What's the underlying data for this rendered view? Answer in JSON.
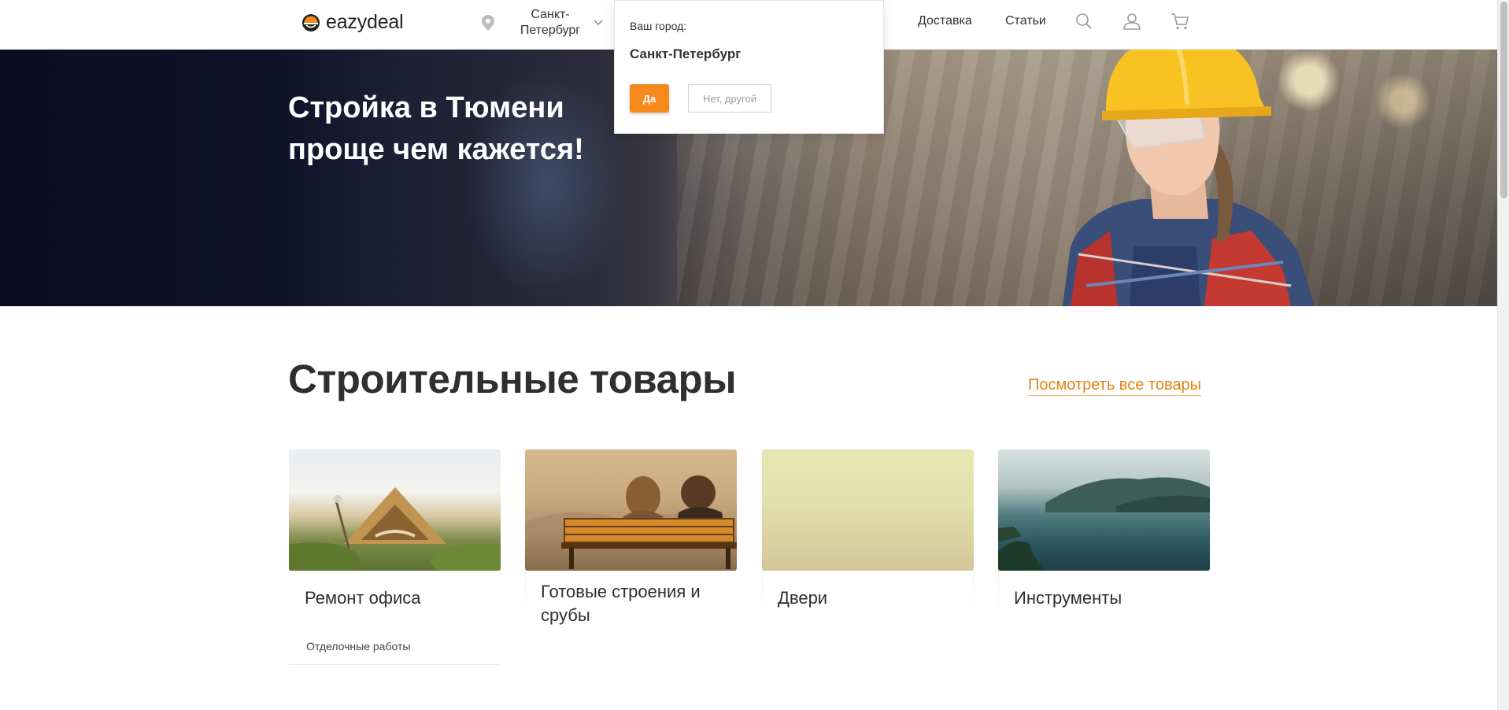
{
  "header": {
    "logo_text": "eazydeal",
    "city": "Санкт-Петербург",
    "nav": [
      {
        "label": "Доставка"
      },
      {
        "label": "Статьи"
      }
    ],
    "icons": [
      "search-icon",
      "user-icon",
      "cart-icon",
      "location-pin-icon",
      "chevron-down-icon"
    ]
  },
  "city_popup": {
    "question": "Ваш город:",
    "city": "Санкт-Петербург",
    "yes_label": "Да",
    "no_label": "Нет, другой"
  },
  "hero": {
    "title": "Стройка в Тюмени проще чем кажется!"
  },
  "section": {
    "title": "Строительные товары",
    "view_all": "Посмотреть все товары"
  },
  "categories": [
    {
      "title": "Ремонт офиса",
      "subitems": [
        "Отделочные работы"
      ]
    },
    {
      "title": "Готовые строения и срубы"
    },
    {
      "title": "Двери"
    },
    {
      "title": "Инструменты"
    }
  ],
  "colors": {
    "accent": "#f5891b",
    "link": "#e08412",
    "hero_dark": "#0c0c22",
    "helmet": "#f7c222"
  }
}
